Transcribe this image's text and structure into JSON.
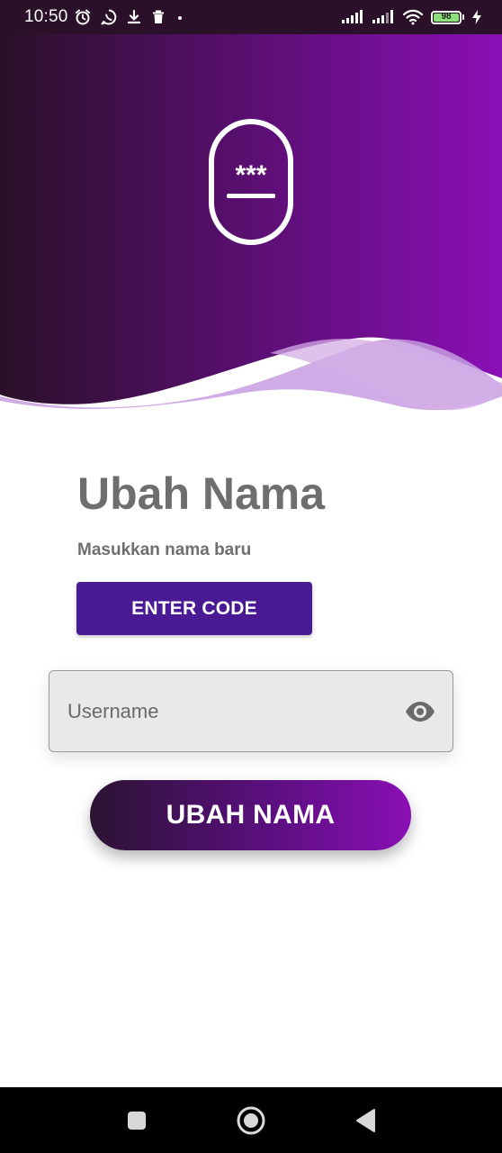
{
  "status_bar": {
    "time": "10:50",
    "battery_level": "98",
    "icons": [
      "alarm-icon",
      "whatsapp-icon",
      "download-icon",
      "trash-icon",
      "dot-icon",
      "signal-icon",
      "signal-icon",
      "wifi-icon",
      "battery-icon",
      "charging-icon"
    ]
  },
  "header": {
    "logo_icon": "password-device-icon",
    "logo_text": "***",
    "gradient_start": "#2a1028",
    "gradient_end": "#8a0fb6",
    "wave_color": "#c79ee0"
  },
  "main": {
    "title": "Ubah Nama",
    "subtitle": "Masukkan nama baru",
    "enter_code_label": "ENTER CODE",
    "username_placeholder": "Username",
    "eye_icon": "eye-icon",
    "submit_label": "UBAH NAMA"
  },
  "nav_bar": {
    "icons": [
      "recent-apps-icon",
      "home-icon",
      "back-icon"
    ]
  },
  "colors": {
    "accent_button": "#4a1a94",
    "title_text": "#6e6e6e",
    "input_background": "#e9e9e9"
  }
}
